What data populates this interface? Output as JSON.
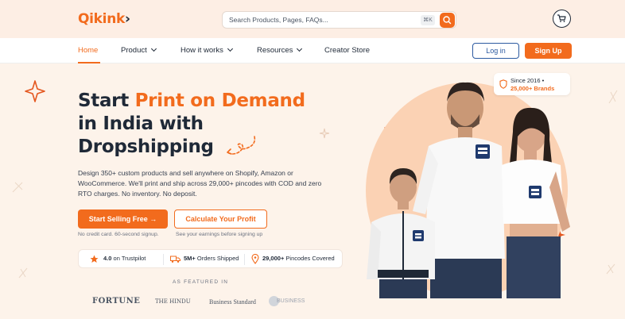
{
  "header": {
    "logo": "Qikink",
    "search_placeholder": "Search Products, Pages, FAQs...",
    "search_shortcut": "⌘K"
  },
  "nav": {
    "items": [
      {
        "label": "Home"
      },
      {
        "label": "Product"
      },
      {
        "label": "How it works"
      },
      {
        "label": "Resources"
      },
      {
        "label": "Creator Store"
      }
    ],
    "login_label": "Log in",
    "signup_label": "Sign Up"
  },
  "hero": {
    "title_part1": "Start ",
    "title_highlight": "Print on Demand",
    "title_line2": "in India with",
    "title_line3": "Dropshipping",
    "description": "Design 350+ custom products and sell anywhere on Shopify, Amazon or WooCommerce. We'll print and ship across 29,000+ pincodes with COD and zero RTO charges. No inventory. No deposit.",
    "cta_primary": "Start Selling Free",
    "cta_primary_note": "No credit card. 60-second signup.",
    "cta_secondary": "Calculate Your Profit",
    "cta_secondary_note": "See your earnings before signing up"
  },
  "stats": [
    {
      "value": "4.0",
      "label": "on Trustpilot"
    },
    {
      "value": "5M+",
      "label": "Orders Shipped"
    },
    {
      "value": "29,000+",
      "label": "Pincodes Covered"
    }
  ],
  "featured": {
    "title": "AS FEATURED IN",
    "brands": [
      "FORTUNE",
      "THE HINDU",
      "Business Standard",
      "BUSINESS"
    ]
  },
  "badge": {
    "line1": "Since 2016 •",
    "line2": "25,000+ Brands"
  },
  "colors": {
    "accent": "#f26b1d",
    "login_border": "#2c5aa0",
    "background": "#fdf3ea"
  }
}
